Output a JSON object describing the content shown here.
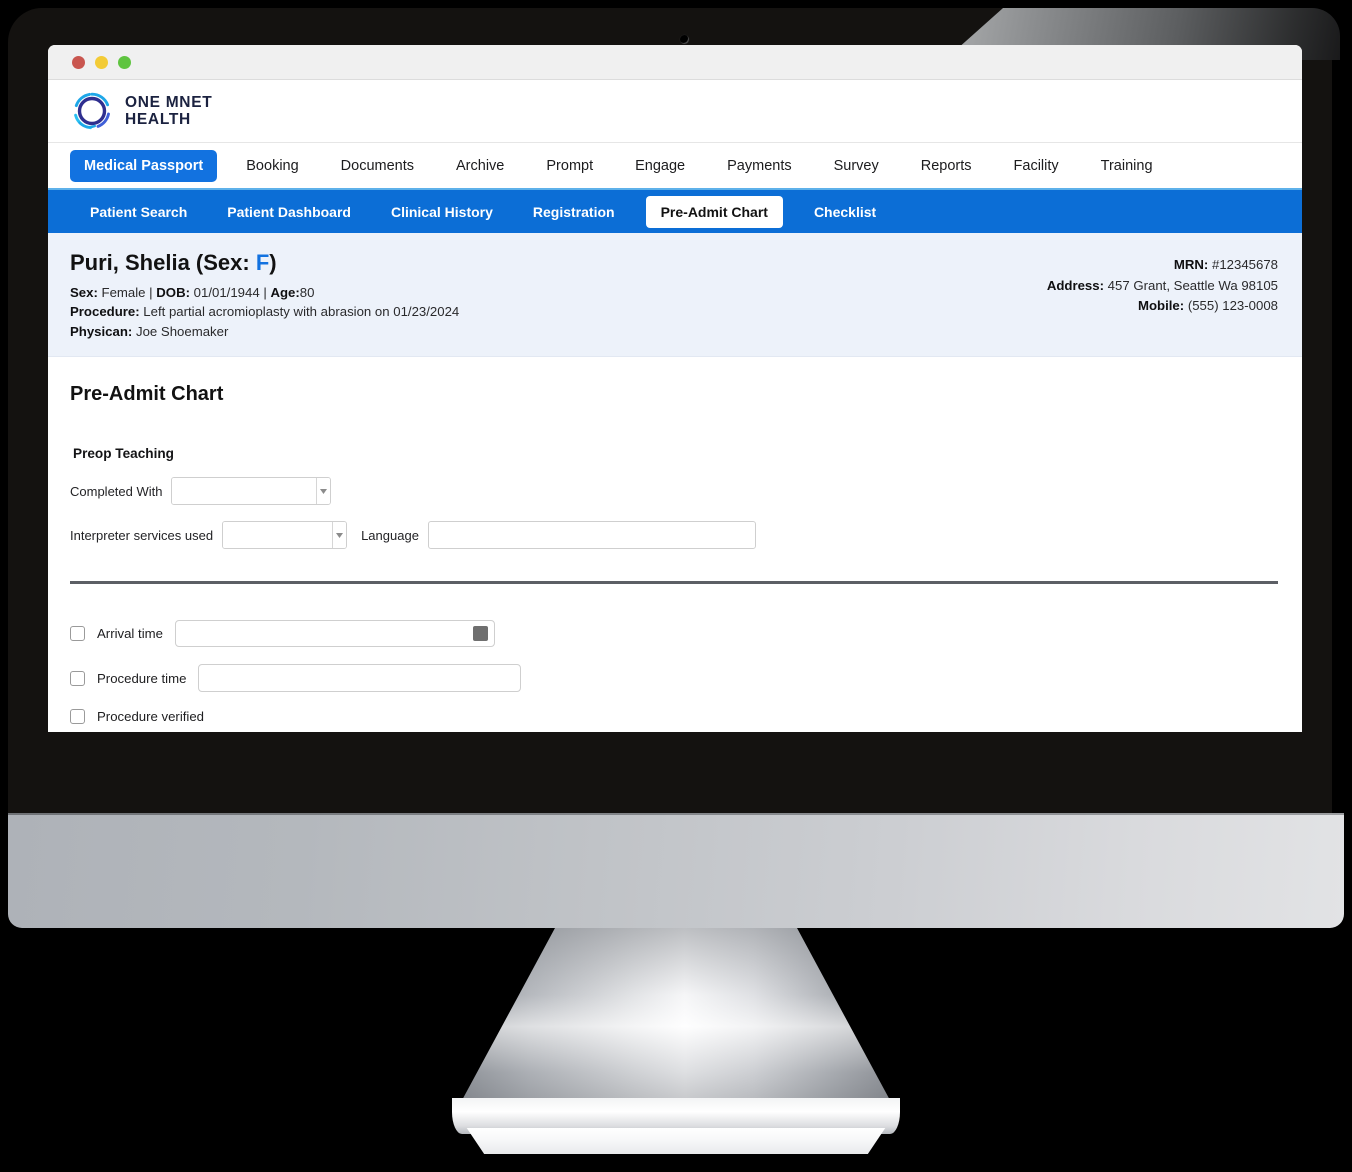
{
  "brand": {
    "logo_icon": "one-mnet-health-circular-swirl-logo",
    "name_line1": "ONE MNET",
    "name_line2": "HEALTH",
    "navy": "#1b2240",
    "cyan": "#29b6f0",
    "accent_blue": "#0c6ed6"
  },
  "window": {
    "traffic_lights": [
      "close",
      "minimize",
      "maximize"
    ],
    "red": "#c9564f",
    "yellow": "#f3cb36",
    "green": "#5fc440"
  },
  "main_nav": {
    "items": [
      {
        "label": "Medical Passport",
        "active": true
      },
      {
        "label": "Booking",
        "active": false
      },
      {
        "label": "Documents",
        "active": false
      },
      {
        "label": "Archive",
        "active": false
      },
      {
        "label": "Prompt",
        "active": false
      },
      {
        "label": "Engage",
        "active": false
      },
      {
        "label": "Payments",
        "active": false
      },
      {
        "label": "Survey",
        "active": false
      },
      {
        "label": "Reports",
        "active": false
      },
      {
        "label": "Facility",
        "active": false
      },
      {
        "label": "Training",
        "active": false
      }
    ]
  },
  "sub_nav": {
    "items": [
      {
        "label": "Patient Search",
        "active": false
      },
      {
        "label": "Patient Dashboard",
        "active": false
      },
      {
        "label": "Clinical History",
        "active": false
      },
      {
        "label": "Registration",
        "active": false
      },
      {
        "label": "Pre-Admit Chart",
        "active": true
      },
      {
        "label": "Checklist",
        "active": false
      }
    ]
  },
  "patient": {
    "name_prefix": "Puri, Shelia (Sex: ",
    "sex_value": "F",
    "name_suffix": ")",
    "sex_label": "Sex:",
    "sex": "Female",
    "sep1": " | ",
    "dob_label": "DOB:",
    "dob": "01/01/1944",
    "sep2": " | ",
    "age_label": "Age:",
    "age": "80",
    "procedure_label": "Procedure:",
    "procedure": "Left partial acromioplasty with abrasion on 01/23/2024",
    "physician_label": "Physican:",
    "physician": "Joe Shoemaker",
    "mrn_label": "MRN:",
    "mrn": "#12345678",
    "address_label": "Address:",
    "address": "457 Grant, Seattle Wa 98105",
    "mobile_label": "Mobile:",
    "mobile": "(555) 123-0008"
  },
  "form": {
    "page_title": "Pre-Admit Chart",
    "section_title": "Preop Teaching",
    "completed_with": {
      "label": "Completed With",
      "value": "",
      "placeholder": "",
      "options": []
    },
    "interpreter": {
      "label": "Interpreter services used",
      "value": "",
      "placeholder": "",
      "options": []
    },
    "language": {
      "label": "Language",
      "value": "",
      "placeholder": ""
    },
    "checks": [
      {
        "label": "Arrival time",
        "checked": false,
        "value": "",
        "placeholder": "",
        "has_picker": true,
        "picker_icon": "clock-picker-icon"
      },
      {
        "label": "Procedure time",
        "checked": false,
        "value": "",
        "placeholder": "",
        "has_picker": false
      },
      {
        "label": "Procedure verified",
        "checked": false,
        "has_input": false
      }
    ]
  }
}
